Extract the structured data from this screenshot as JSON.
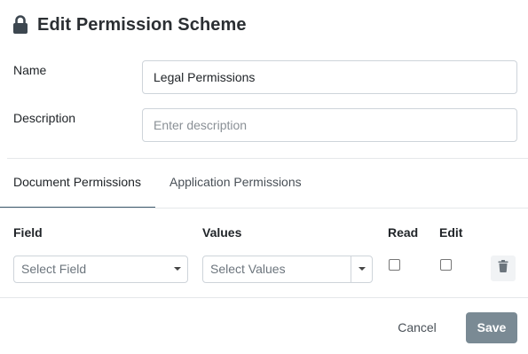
{
  "header": {
    "title": "Edit Permission Scheme",
    "icon": "lock-icon"
  },
  "form": {
    "name_label": "Name",
    "name_value": "Legal Permissions",
    "description_label": "Description",
    "description_placeholder": "Enter description"
  },
  "tabs": [
    {
      "label": "Document Permissions",
      "active": true
    },
    {
      "label": "Application Permissions",
      "active": false
    }
  ],
  "table": {
    "headers": {
      "field": "Field",
      "values": "Values",
      "read": "Read",
      "edit": "Edit"
    },
    "row": {
      "field_placeholder": "Select Field",
      "values_placeholder": "Select Values",
      "read": false,
      "edit": false
    }
  },
  "footer": {
    "cancel_label": "Cancel",
    "save_label": "Save"
  },
  "colors": {
    "tab_underline": "#3f5b6e",
    "save_button": "#7a8a94",
    "lock_icon": "#3d4750"
  }
}
